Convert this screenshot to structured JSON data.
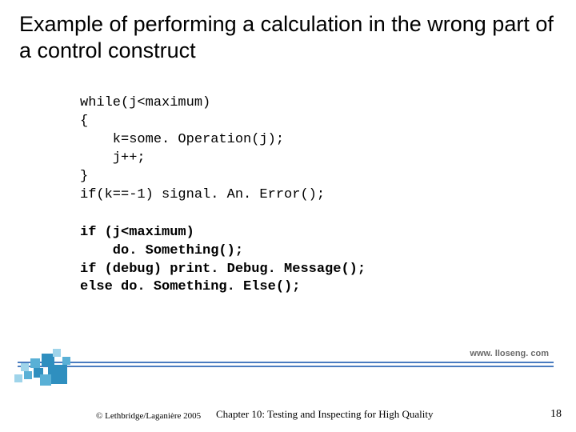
{
  "title": "Example of performing a calculation in the wrong part of a control construct",
  "code_block_1": "while(j<maximum)\n{\n    k=some. Operation(j);\n    j++;\n}\nif(k==-1) signal. An. Error();",
  "code_block_2": "if (j<maximum)\n    do. Something();\nif (debug) print. Debug. Message();\nelse do. Something. Else();",
  "url": "www. lloseng. com",
  "copyright": "© Lethbridge/Laganière 2005",
  "chapter": "Chapter 10: Testing and Inspecting for High Quality",
  "page_number": "18"
}
